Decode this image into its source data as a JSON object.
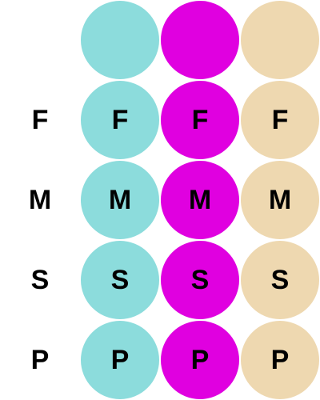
{
  "palette": {
    "columns": [
      {
        "color": "#8cdcdc"
      },
      {
        "color": "#e000e0"
      },
      {
        "color": "#eed8b0"
      }
    ]
  },
  "rows": [
    {
      "label": "F",
      "cells": [
        "F",
        "F",
        "F"
      ]
    },
    {
      "label": "M",
      "cells": [
        "M",
        "M",
        "M"
      ]
    },
    {
      "label": "S",
      "cells": [
        "S",
        "S",
        "S"
      ]
    },
    {
      "label": "P",
      "cells": [
        "P",
        "P",
        "P"
      ]
    }
  ]
}
